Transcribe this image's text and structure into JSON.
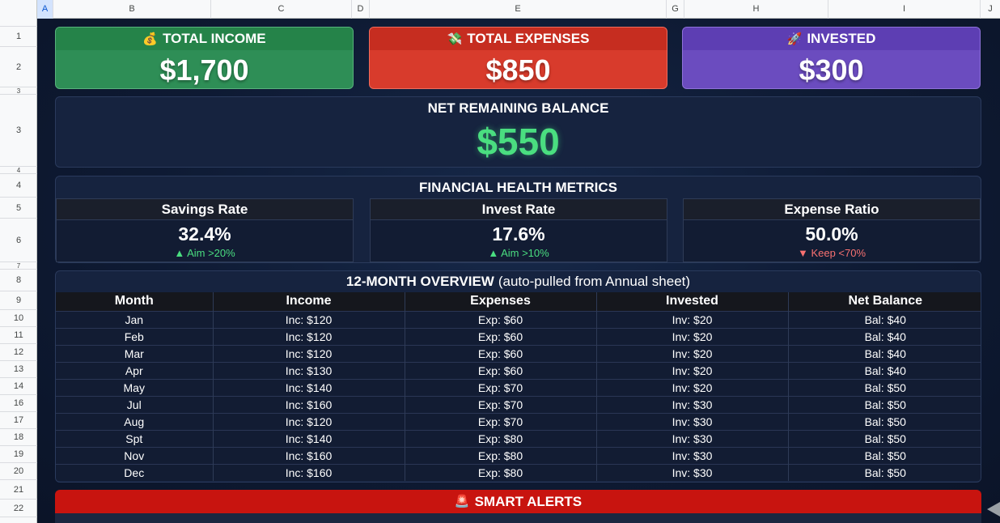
{
  "columns": [
    "A",
    "B",
    "C",
    "D",
    "E",
    "G",
    "H",
    "I",
    "J"
  ],
  "rows": [
    "1",
    "2",
    "3",
    "3",
    "4",
    "4",
    "5",
    "6",
    "7",
    "8",
    "9",
    "10",
    "11",
    "12",
    "13",
    "14",
    "16",
    "17",
    "18",
    "19",
    "20",
    "21",
    "22"
  ],
  "summary": {
    "income": {
      "icon": "💰",
      "label": "TOTAL INCOME",
      "value": "$1,700"
    },
    "expenses": {
      "icon": "💸",
      "label": "TOTAL EXPENSES",
      "value": "$850"
    },
    "invested": {
      "icon": "🚀",
      "label": "INVESTED",
      "value": "$300"
    }
  },
  "net": {
    "label": "NET REMAINING BALANCE",
    "value": "$550"
  },
  "metrics": {
    "title": "FINANCIAL HEALTH METRICS",
    "items": [
      {
        "label": "Savings Rate",
        "value": "32.4%",
        "sub": "▲ Aim >20%",
        "status": "good"
      },
      {
        "label": "Invest Rate",
        "value": "17.6%",
        "sub": "▲ Aim >10%",
        "status": "good"
      },
      {
        "label": "Expense Ratio",
        "value": "50.0%",
        "sub": "▼ Keep <70%",
        "status": "warn"
      }
    ]
  },
  "overview": {
    "title": "12-MONTH OVERVIEW",
    "subtitle": "(auto-pulled from Annual sheet)",
    "headers": [
      "Month",
      "Income",
      "Expenses",
      "Invested",
      "Net Balance"
    ],
    "rows": [
      [
        "Jan",
        "Inc: $120",
        "Exp: $60",
        "Inv: $20",
        "Bal: $40"
      ],
      [
        "Feb",
        "Inc: $120",
        "Exp: $60",
        "Inv: $20",
        "Bal: $40"
      ],
      [
        "Mar",
        "Inc: $120",
        "Exp: $60",
        "Inv: $20",
        "Bal: $40"
      ],
      [
        "Apr",
        "Inc: $130",
        "Exp: $60",
        "Inv: $20",
        "Bal: $40"
      ],
      [
        "May",
        "Inc: $140",
        "Exp: $70",
        "Inv: $20",
        "Bal: $50"
      ],
      [
        "Jul",
        "Inc: $160",
        "Exp: $70",
        "Inv: $30",
        "Bal: $50"
      ],
      [
        "Aug",
        "Inc: $120",
        "Exp: $70",
        "Inv: $30",
        "Bal: $50"
      ],
      [
        "Spt",
        "Inc: $140",
        "Exp: $80",
        "Inv: $30",
        "Bal: $50"
      ],
      [
        "Nov",
        "Inc: $160",
        "Exp: $80",
        "Inv: $30",
        "Bal: $50"
      ],
      [
        "Dec",
        "Inc: $160",
        "Exp: $80",
        "Inv: $30",
        "Bal: $50"
      ]
    ]
  },
  "alerts": {
    "icon": "🚨",
    "label": "SMART ALERTS"
  },
  "colors": {
    "income": "#2e8e56",
    "expenses": "#d83b2c",
    "invested": "#6b4cbf",
    "net": "#4ade80",
    "alert": "#c8140f",
    "good": "#4ade80",
    "warn": "#f87171"
  }
}
